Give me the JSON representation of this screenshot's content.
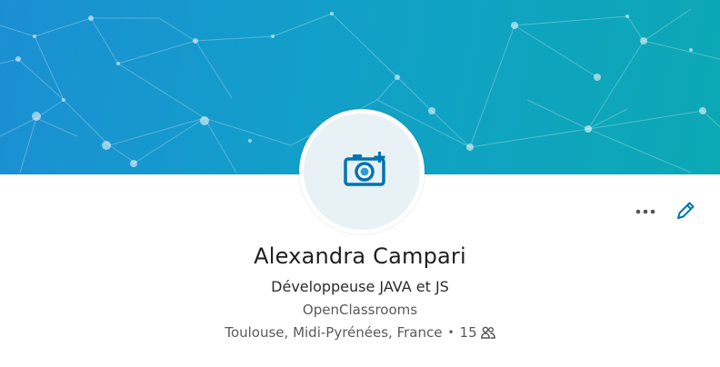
{
  "profile": {
    "name": "Alexandra Campari",
    "headline": "Développeuse JAVA et JS",
    "company": "OpenClassrooms",
    "location": "Toulouse, Midi-Pyrénées, France",
    "separator": "•",
    "connections": "15"
  },
  "actions": {
    "more_label": "•••"
  },
  "icons": {
    "photo": "camera-add-icon",
    "more": "more-icon",
    "edit": "pencil-icon",
    "connections": "people-icon"
  },
  "colors": {
    "banner_start": "#1b8fd3",
    "banner_end": "#0ca8b4",
    "accent": "#0073b1",
    "avatar_bg": "#e8f1f5"
  }
}
